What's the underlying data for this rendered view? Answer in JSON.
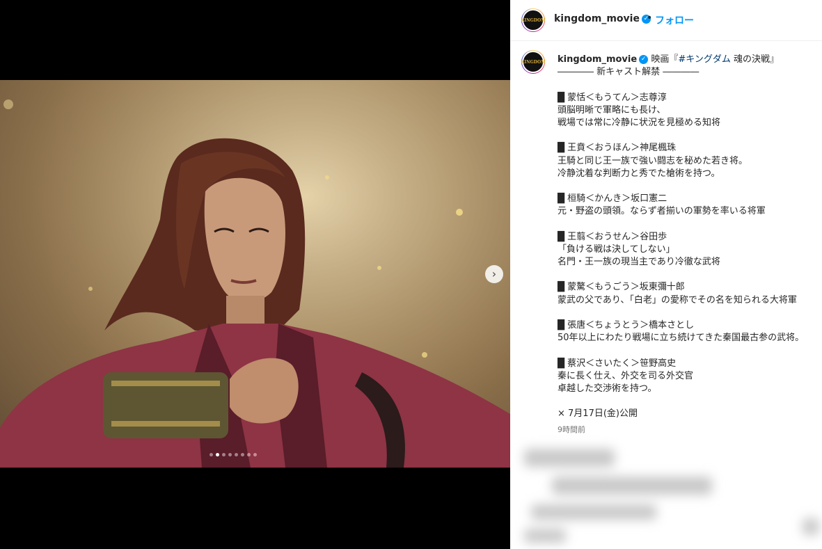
{
  "header": {
    "avatar_text": "KINGDOM",
    "username": "kingdom_movie",
    "verified": "✓",
    "separator": "•",
    "follow_label": "フォロー"
  },
  "media": {
    "next_icon": "chevron-right-icon",
    "next_glyph": "›",
    "carousel_total": 8,
    "carousel_active": 2
  },
  "caption": {
    "username": "kingdom_movie",
    "verified": "✓",
    "lines": [
      {
        "pre": "映画『",
        "tag": "#キングダム",
        "post": " 魂の決戦』"
      },
      {
        "text": "―――― 新キャスト解禁 ――――"
      },
      {
        "text": ""
      },
      {
        "text": "█ 蒙恬＜もうてん＞志尊淳"
      },
      {
        "text": "頭脳明晰で軍略にも長け、"
      },
      {
        "text": "戦場では常に冷静に状況を見極める知将"
      },
      {
        "text": ""
      },
      {
        "text": "█ 王賁＜おうほん＞神尾楓珠"
      },
      {
        "text": "王騎と同じ王一族で強い闘志を秘めた若き将。"
      },
      {
        "text": "冷静沈着な判断力と秀でた槍術を持つ。"
      },
      {
        "text": ""
      },
      {
        "text": "█ 桓騎＜かんき＞坂口憲二"
      },
      {
        "text": "元・野盗の頭領。ならず者揃いの軍勢を率いる将軍"
      },
      {
        "text": ""
      },
      {
        "text": "█ 王翦＜おうせん＞谷田歩"
      },
      {
        "text": "「負ける戦は決してしない」"
      },
      {
        "text": "名門・王一族の現当主であり冷徹な武将"
      },
      {
        "text": ""
      },
      {
        "text": "█ 蒙驁＜もうごう＞坂東彌十郎"
      },
      {
        "text": "蒙武の父であり、「白老」の愛称でその名を知られる大将軍"
      },
      {
        "text": ""
      },
      {
        "text": "█ 張唐＜ちょうとう＞橋本さとし"
      },
      {
        "text": "50年以上にわたり戦場に立ち続けてきた秦国最古参の武将。"
      },
      {
        "text": ""
      },
      {
        "text": "█ 蔡沢＜さいたく＞笹野高史"
      },
      {
        "text": "秦に長く仕え、外交を司る外交官"
      },
      {
        "text": "卓越した交渉術を持つ。"
      },
      {
        "text": ""
      },
      {
        "text": "× 7月17日(金)公開"
      }
    ],
    "timestamp": "9時間前"
  },
  "colors": {
    "link": "#0095f6",
    "hashtag": "#00376b",
    "text": "#262626",
    "muted": "#737373"
  }
}
